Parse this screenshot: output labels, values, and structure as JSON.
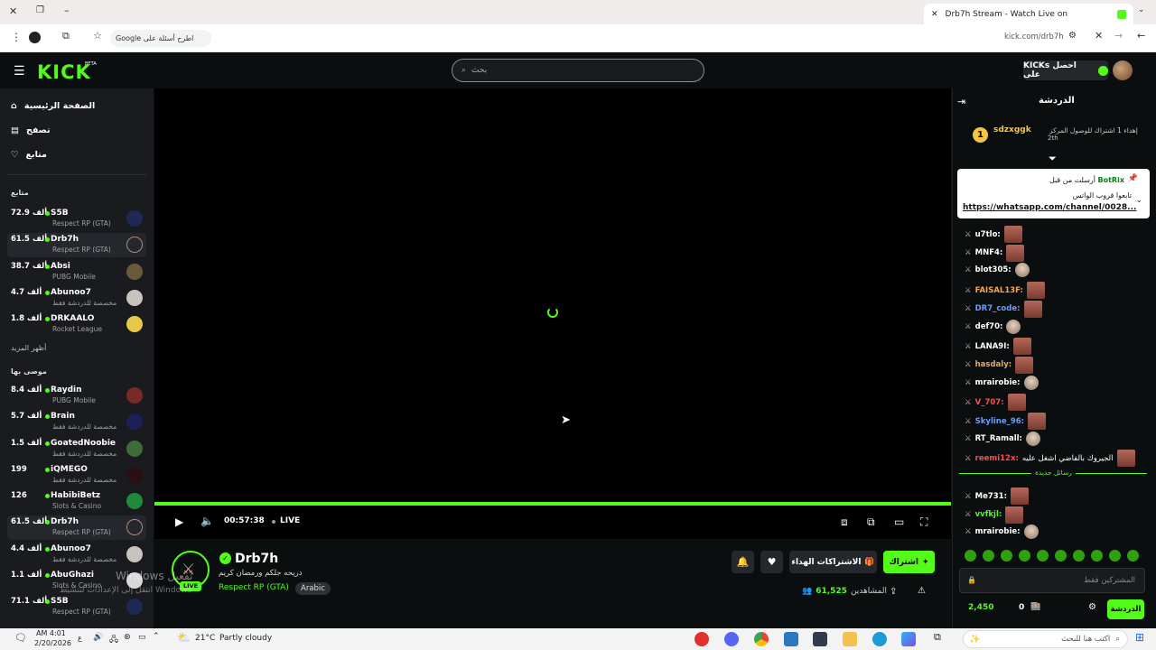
{
  "browser": {
    "tab_title": "Drb7h Stream - Watch Live on",
    "url": "kick.com/drb7h",
    "google_search_placeholder": "Google اطرح أسئلة على"
  },
  "header": {
    "logo": "KICK",
    "logo_badge": "BETA",
    "search_placeholder": "بحث",
    "get_kicks": "KICKs احصل على"
  },
  "sidebar": {
    "nav": [
      "الصفحة الرئيسية",
      "تصفح",
      "متابع"
    ],
    "following_label": "متابع",
    "show_more": "أظهر المزيد",
    "recommended_label": "موصى بها",
    "following": [
      {
        "viewers": "72.9 ألف",
        "name": "S5B",
        "category": "Respect RP (GTA)"
      },
      {
        "viewers": "61.5 ألف",
        "name": "Drb7h",
        "category": "Respect RP (GTA)"
      },
      {
        "viewers": "38.7 ألف",
        "name": "Absi",
        "category": "PUBG Mobile"
      },
      {
        "viewers": "4.7 ألف",
        "name": "Abunoo7",
        "category": "مخصصة للدردشة فقط"
      },
      {
        "viewers": "1.8 ألف",
        "name": "DRKAALO",
        "category": "Rocket League"
      }
    ],
    "recommended": [
      {
        "viewers": "8.4 ألف",
        "name": "Raydin",
        "category": "PUBG Mobile"
      },
      {
        "viewers": "5.7 ألف",
        "name": "Brain",
        "category": "مخصصة للدردشة فقط"
      },
      {
        "viewers": "1.5 ألف",
        "name": "GoatedNoobie",
        "category": "مخصصة للدردشة فقط"
      },
      {
        "viewers": "199",
        "name": "iQMEGO",
        "category": "مخصصة للدردشة فقط"
      },
      {
        "viewers": "126",
        "name": "HabibiBetz",
        "category": "Slots & Casino"
      },
      {
        "viewers": "61.5 ألف",
        "name": "Drb7h",
        "category": "Respect RP (GTA)"
      },
      {
        "viewers": "4.4 ألف",
        "name": "Abunoo7",
        "category": "مخصصة للدردشة فقط"
      },
      {
        "viewers": "1.1 ألف",
        "name": "AbuGhazi",
        "category": "Slots & Casino"
      },
      {
        "viewers": "71.1 ألف",
        "name": "S5B",
        "category": "Respect RP (GTA)"
      }
    ]
  },
  "player": {
    "time": "00:57:38",
    "live": "LIVE",
    "progress_fraction": 1.0
  },
  "stream": {
    "name": "Drb7h",
    "title": "دريحه جلكم ورمضان كريم",
    "category": "Respect RP (GTA)",
    "language": "Arabic",
    "live_badge": "LIVE",
    "follow_label": "اشتراك",
    "gift_label": "الاشتراكات الهداء",
    "viewers": "61,525",
    "viewers_label": "المشاهدين"
  },
  "chat": {
    "title": "الدردشة",
    "top_user": "sdzxggk",
    "top_rank": "1",
    "top_note": "إهداء 1 اشتراك للوصول المركز",
    "top_place": "2th",
    "pinned_author": "BotRix",
    "pinned_prefix": "أرسلت من قبل",
    "pinned_text": "تابعوا قروب الواتس",
    "pinned_link": "https://whatsapp.com/channel/0028...",
    "messages": [
      {
        "user": "u7tlo:",
        "color": "#ffffff"
      },
      {
        "user": "MNF4:",
        "color": "#ffffff"
      },
      {
        "user": "blot305:",
        "color": "#ffffff"
      },
      {
        "user": "FAISAL13F:",
        "color": "#f2a65a"
      },
      {
        "user": "DR7_code:",
        "color": "#6b9cff"
      },
      {
        "user": "def70:",
        "color": "#ffffff"
      },
      {
        "user": "LANA9I:",
        "color": "#ffffff"
      },
      {
        "user": "hasdaly:",
        "color": "#f2a65a"
      },
      {
        "user": "mrairobie:",
        "color": "#ffffff"
      },
      {
        "user": "V_707:",
        "color": "#ff4d4d"
      },
      {
        "user": "Skyline_96:",
        "color": "#6b9cff"
      },
      {
        "user": "RT_Ramall:",
        "color": "#ffffff"
      },
      {
        "user": "reemi12x:",
        "color": "#ff4d4d",
        "text": "الجيروك بالفاضي اشغل عليه"
      }
    ],
    "new_messages_label": "رسائل جديدة",
    "messages_after": [
      {
        "user": "Me731:",
        "color": "#ffffff"
      },
      {
        "user": "vvfkjl:",
        "color": "#53fc18"
      },
      {
        "user": "mrairobie:",
        "color": "#ffffff"
      }
    ],
    "input_placeholder": "المشتركين فقط",
    "kicks_balance": "2,450",
    "points": "0",
    "send_label": "الدردشة"
  },
  "watermark": {
    "line1": "Windows تفعيل",
    "line2": "انتقل إلى الإعدادات لتنشيط Windows"
  },
  "taskbar": {
    "time": "AM 4:01",
    "date": "2/20/2026",
    "weather_temp": "21°C",
    "weather_desc": "Partly cloudy",
    "search_placeholder": "اكتب هنا للبحث"
  }
}
